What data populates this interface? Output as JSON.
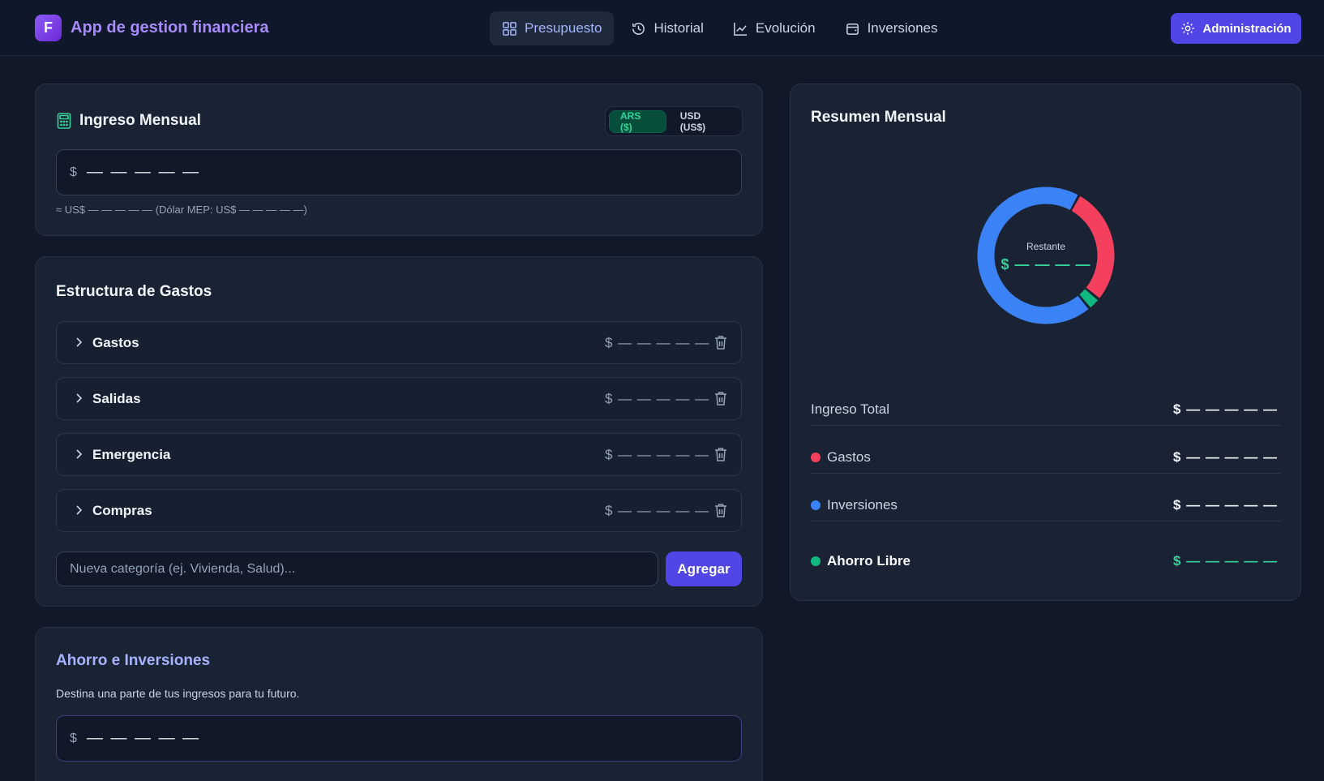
{
  "header": {
    "brand_initial": "F",
    "brand_title": "App de gestion financiera",
    "tabs": [
      {
        "label": "Presupuesto",
        "icon": "grid-icon",
        "active": true
      },
      {
        "label": "Historial",
        "icon": "history-icon",
        "active": false
      },
      {
        "label": "Evolución",
        "icon": "chart-line-icon",
        "active": false
      },
      {
        "label": "Inversiones",
        "icon": "wallet-icon",
        "active": false
      }
    ],
    "admin_label": "Administración"
  },
  "income": {
    "title": "Ingreso Mensual",
    "currency_options": [
      {
        "label": "ARS ($)",
        "active": true
      },
      {
        "label": "USD (US$)",
        "active": false
      }
    ],
    "symbol": "$",
    "value": "— — — — —",
    "hint": "≈ US$ — — — — — (Dólar MEP: US$ — — — — —)"
  },
  "expenses": {
    "title": "Estructura de Gastos",
    "categories": [
      {
        "name": "Gastos",
        "amount": "$ — — — — —"
      },
      {
        "name": "Salidas",
        "amount": "$ — — — — —"
      },
      {
        "name": "Emergencia",
        "amount": "$ — — — — —"
      },
      {
        "name": "Compras",
        "amount": "$ — — — — —"
      }
    ],
    "new_placeholder": "Nueva categoría (ej. Vivienda, Salud)...",
    "add_label": "Agregar"
  },
  "savings": {
    "title": "Ahorro e Inversiones",
    "description": "Destina una parte de tus ingresos para tu futuro.",
    "symbol": "$",
    "value": "— — — — —"
  },
  "summary": {
    "title": "Resumen Mensual",
    "donut_label": "Restante",
    "donut_value": "$ — — — —",
    "donut_segments": [
      {
        "name": "Gastos",
        "fraction": 0.28,
        "color": "#f43f5e"
      },
      {
        "name": "Ahorro Libre",
        "fraction": 0.03,
        "color": "#10b981"
      },
      {
        "name": "Inversiones",
        "fraction": 0.69,
        "color": "#3b82f6"
      }
    ],
    "rows": [
      {
        "label": "Ingreso Total",
        "amount": "$ — — — — —"
      },
      {
        "label": "Gastos",
        "amount": "$ — — — — —",
        "color": "#f43f5e"
      },
      {
        "label": "Inversiones",
        "amount": "$ — — — — —",
        "color": "#3b82f6"
      },
      {
        "label": "Ahorro Libre",
        "amount": "$ — — — — —",
        "color": "#10b981"
      }
    ]
  }
}
